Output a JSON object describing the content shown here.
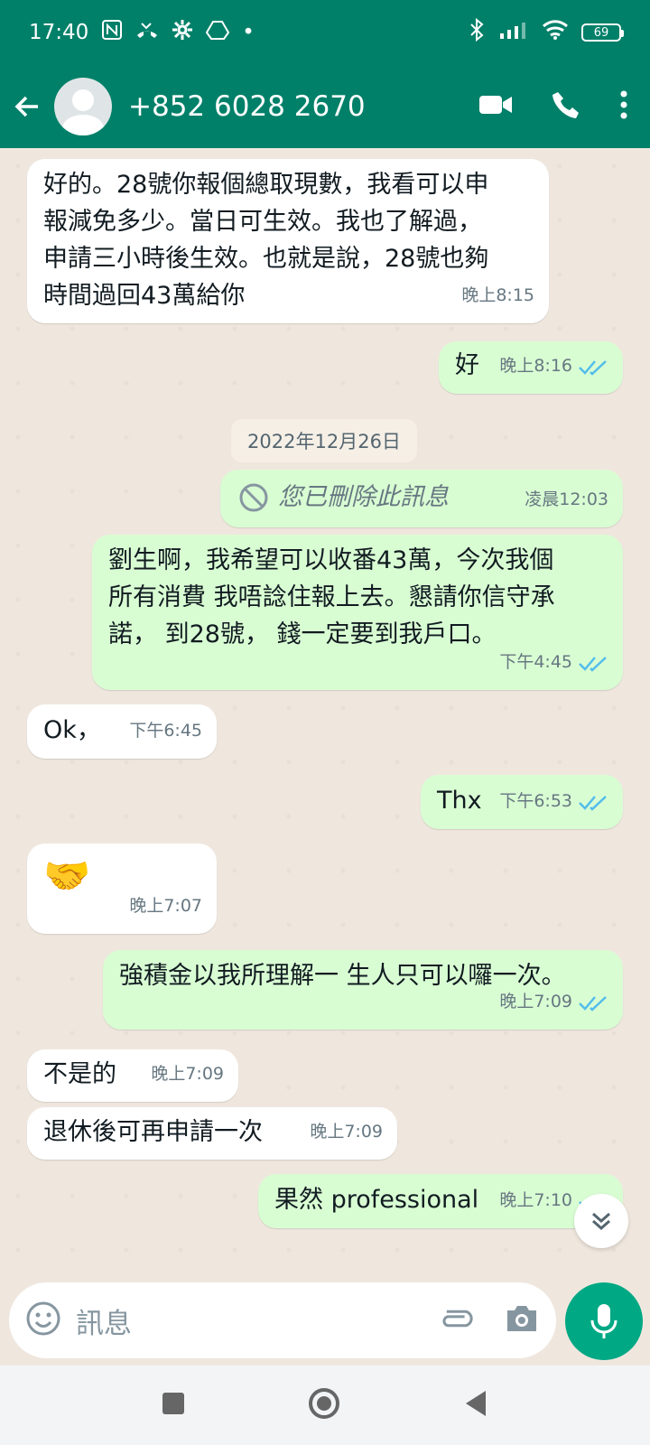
{
  "status_bar": {
    "time": "17:40",
    "battery": "69"
  },
  "header": {
    "title": "+852 6028 2670"
  },
  "messages": [
    {
      "type": "incoming",
      "text_lines": [
        "好的。28號你報個總取現數，我看可以申",
        "報減免多少。當日可生效。我也了解過，",
        "申請三小時後生效。也就是說，28號也夠",
        "時間過回43萬給你"
      ],
      "time": "晚上8:15"
    },
    {
      "type": "outgoing",
      "text": "好",
      "time": "晚上8:16"
    },
    {
      "type": "date",
      "text": "2022年12月26日"
    },
    {
      "type": "outgoing_deleted",
      "text": "您已刪除此訊息",
      "time": "凌晨12:03"
    },
    {
      "type": "outgoing",
      "text_lines": [
        "劉生啊，我希望可以收番43萬，今次我個",
        "所有消費 我唔諗住報上去。懇請你信守承",
        "諾， 到28號， 錢一定要到我戶口。"
      ],
      "time": "下午4:45"
    },
    {
      "type": "incoming",
      "text": "Ok，",
      "time": "下午6:45"
    },
    {
      "type": "outgoing",
      "text": "Thx",
      "time": "下午6:53"
    },
    {
      "type": "incoming",
      "text": "🤝",
      "time": "晚上7:07"
    },
    {
      "type": "outgoing",
      "text": "強積金以我所理解一 生人只可以囉一次。",
      "time": "晚上7:09"
    },
    {
      "type": "incoming",
      "text": "不是的",
      "time": "晚上7:09"
    },
    {
      "type": "incoming",
      "text": "退休後可再申請一次",
      "time": "晚上7:09"
    },
    {
      "type": "outgoing",
      "text": "果然 professional",
      "time": "晚上7:10"
    }
  ],
  "composer": {
    "placeholder": "訊息"
  },
  "colors": {
    "header": "#008069",
    "incoming": "#ffffff",
    "outgoing": "#d9fdd3",
    "accent": "#00a884",
    "read_ticks": "#53bdeb"
  }
}
